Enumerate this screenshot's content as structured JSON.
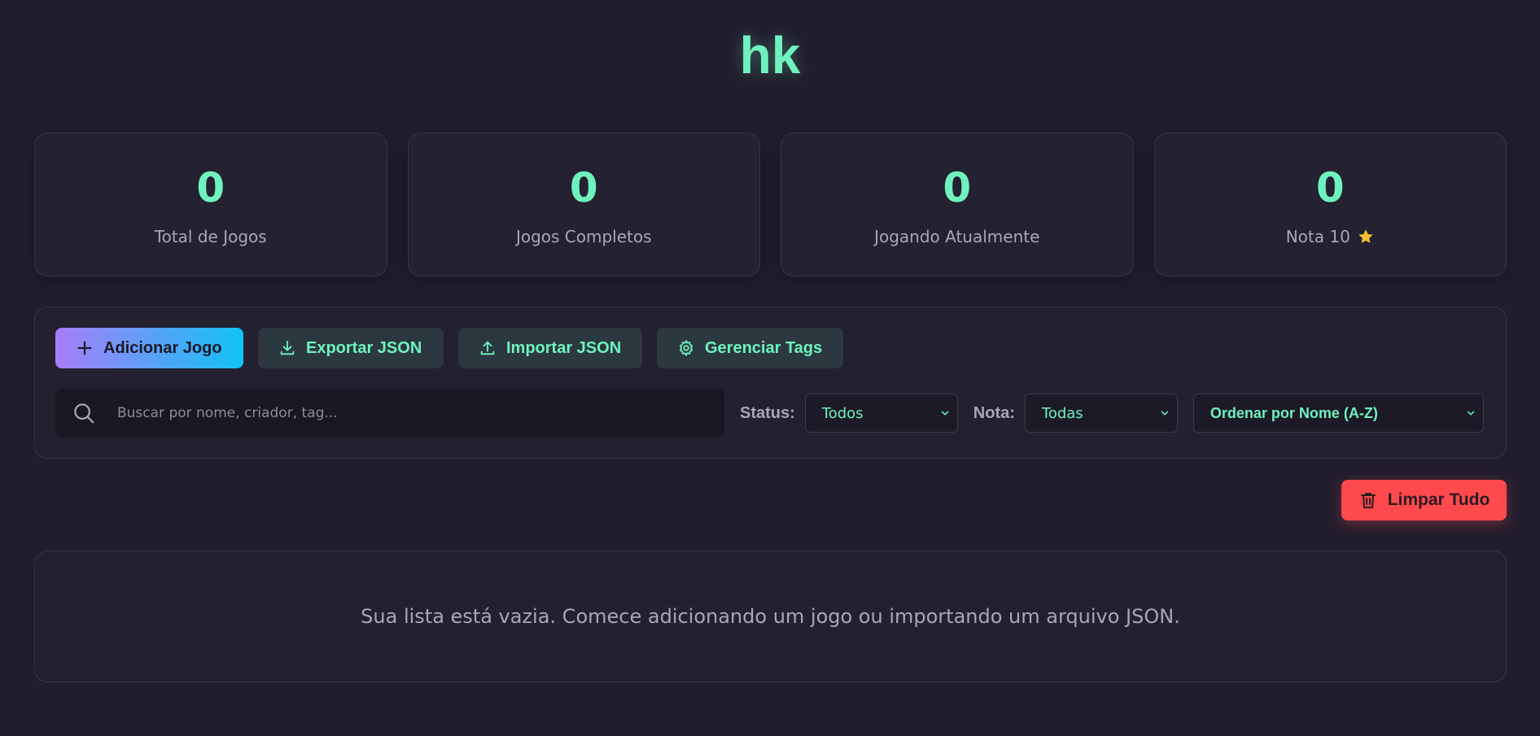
{
  "header": {
    "title": "hk"
  },
  "stats": [
    {
      "value": "0",
      "label": "Total de Jogos"
    },
    {
      "value": "0",
      "label": "Jogos Completos"
    },
    {
      "value": "0",
      "label": "Jogando Atualmente"
    },
    {
      "value": "0",
      "label": "Nota 10",
      "icon": "star-icon"
    }
  ],
  "toolbar": {
    "add_label": "Adicionar Jogo",
    "export_label": "Exportar JSON",
    "import_label": "Importar JSON",
    "tags_label": "Gerenciar Tags"
  },
  "filters": {
    "search_placeholder": "Buscar por nome, criador, tag...",
    "status_label": "Status:",
    "status_value": "Todos",
    "rating_label": "Nota:",
    "rating_value": "Todas",
    "sort_value": "Ordenar por Nome (A-Z)"
  },
  "actions": {
    "clear_label": "Limpar Tudo"
  },
  "list": {
    "empty_message": "Sua lista está vazia. Comece adicionando um jogo ou importando um arquivo JSON."
  },
  "colors": {
    "background": "#211d2d",
    "accent": "#6ff2bd",
    "danger": "#ff4a4d",
    "gradient_start": "#a77ef7",
    "gradient_end": "#12c2f7",
    "star": "#f5c12e"
  }
}
